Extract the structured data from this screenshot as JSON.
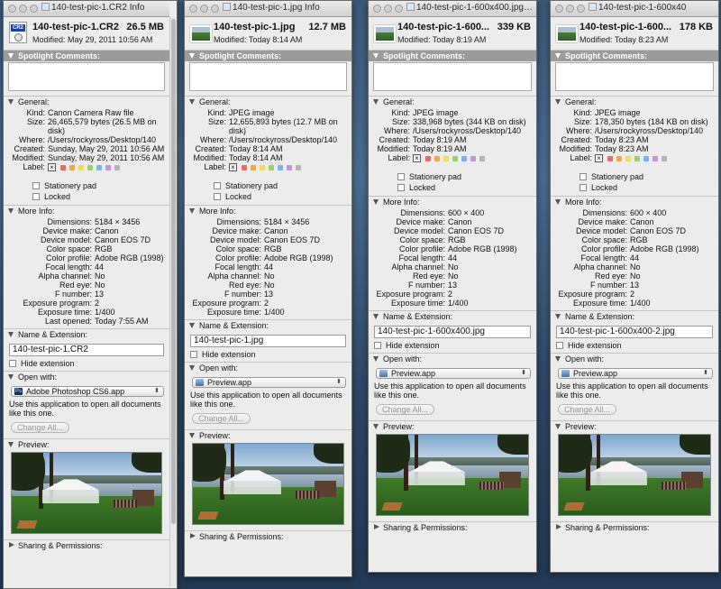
{
  "labels": {
    "spotlight": "Spotlight Comments:",
    "general": "General:",
    "more_info": "More Info:",
    "name_ext": "Name & Extension:",
    "open_with": "Open with:",
    "preview": "Preview:",
    "sharing": "Sharing & Permissions:",
    "stationery": "Stationery pad",
    "locked": "Locked",
    "hide_ext": "Hide extension",
    "use_app": "Use this application to open all documents like this one.",
    "change_all": "Change All...",
    "k_kind": "Kind:",
    "k_size": "Size:",
    "k_where": "Where:",
    "k_created": "Created:",
    "k_modified": "Modified:",
    "k_label": "Label:",
    "k_dimensions": "Dimensions:",
    "k_device_make": "Device make:",
    "k_device_model": "Device model:",
    "k_color_space": "Color space:",
    "k_color_profile": "Color profile:",
    "k_focal": "Focal length:",
    "k_alpha": "Alpha channel:",
    "k_redeye": "Red eye:",
    "k_fnum": "F number:",
    "k_exp_prog": "Exposure program:",
    "k_exp_time": "Exposure time:",
    "k_last_opened": "Last opened:"
  },
  "label_colors": [
    "#e86a6a",
    "#f2a64a",
    "#eedd55",
    "#9ad068",
    "#7cb2ee",
    "#c793dc",
    "#b5b5b5"
  ],
  "windows": [
    {
      "title": "140-test-pic-1.CR2 Info",
      "file_name": "140-test-pic-1.CR2",
      "file_size": "26.5 MB",
      "modified_header": "Modified: May 29, 2011 10:56 AM",
      "general": {
        "kind": "Canon Camera Raw file",
        "size": "26,465,579 bytes (26.5 MB on disk)",
        "where": "/Users/rockyross/Desktop/140",
        "created": "Sunday, May 29, 2011 10:56 AM",
        "modified": "Sunday, May 29, 2011 10:56 AM"
      },
      "more": {
        "dimensions": "5184 × 3456",
        "device_make": "Canon",
        "device_model": "Canon EOS 7D",
        "color_space": "RGB",
        "color_profile": "Adobe RGB (1998)",
        "focal": "44",
        "alpha": "No",
        "redeye": "No",
        "fnum": "13",
        "exp_prog": "2",
        "exp_time": "1/400",
        "last_opened": "Today 7:55 AM"
      },
      "name_field": "140-test-pic-1.CR2",
      "open_with_app": "Adobe Photoshop CS6.app",
      "app_icon": "photoshop-icon"
    },
    {
      "title": "140-test-pic-1.jpg Info",
      "file_name": "140-test-pic-1.jpg",
      "file_size": "12.7 MB",
      "modified_header": "Modified: Today 8:14 AM",
      "general": {
        "kind": "JPEG image",
        "size": "12,655,893 bytes (12.7 MB on disk)",
        "where": "/Users/rockyross/Desktop/140",
        "created": "Today 8:14 AM",
        "modified": "Today 8:14 AM"
      },
      "more": {
        "dimensions": "5184 × 3456",
        "device_make": "Canon",
        "device_model": "Canon EOS 7D",
        "color_space": "RGB",
        "color_profile": "Adobe RGB (1998)",
        "focal": "44",
        "alpha": "No",
        "redeye": "No",
        "fnum": "13",
        "exp_prog": "2",
        "exp_time": "1/400"
      },
      "name_field": "140-test-pic-1.jpg",
      "open_with_app": "Preview.app",
      "app_icon": "preview-icon"
    },
    {
      "title": "140-test-pic-1-600x400.jpg Info",
      "file_name": "140-test-pic-1-600...",
      "file_size": "339 KB",
      "modified_header": "Modified: Today 8:19 AM",
      "general": {
        "kind": "JPEG image",
        "size": "338,968 bytes (344 KB on disk)",
        "where": "/Users/rockyross/Desktop/140",
        "created": "Today 8:19 AM",
        "modified": "Today 8:19 AM"
      },
      "more": {
        "dimensions": "600 × 400",
        "device_make": "Canon",
        "device_model": "Canon EOS 7D",
        "color_space": "RGB",
        "color_profile": "Adobe RGB (1998)",
        "focal": "44",
        "alpha": "No",
        "redeye": "No",
        "fnum": "13",
        "exp_prog": "2",
        "exp_time": "1/400"
      },
      "name_field": "140-test-pic-1-600x400.jpg",
      "open_with_app": "Preview.app",
      "app_icon": "preview-icon"
    },
    {
      "title": "140-test-pic-1-600x40",
      "file_name": "140-test-pic-1-600...",
      "file_size": "178 KB",
      "modified_header": "Modified: Today 8:23 AM",
      "general": {
        "kind": "JPEG image",
        "size": "178,350 bytes (184 KB on disk)",
        "where": "/Users/rockyross/Desktop/140",
        "created": "Today 8:23 AM",
        "modified": "Today 8:23 AM"
      },
      "more": {
        "dimensions": "600 × 400",
        "device_make": "Canon",
        "device_model": "Canon EOS 7D",
        "color_space": "RGB",
        "color_profile": "Adobe RGB (1998)",
        "focal": "44",
        "alpha": "No",
        "redeye": "No",
        "fnum": "13",
        "exp_prog": "2",
        "exp_time": "1/400"
      },
      "name_field": "140-test-pic-1-600x400-2.jpg",
      "open_with_app": "Preview.app",
      "app_icon": "preview-icon"
    }
  ]
}
